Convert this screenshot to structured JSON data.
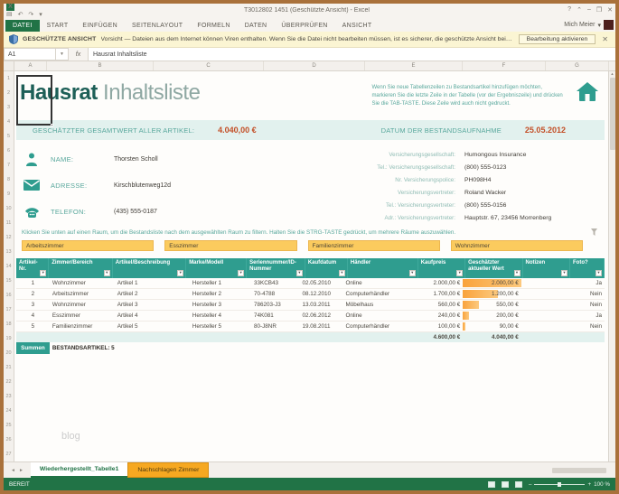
{
  "colors": {
    "excel_green": "#217346",
    "accent_teal": "#2f9d8f",
    "value_orange": "#c34f27",
    "slicer_orange": "#fbcb5e",
    "databar_orange": "#f9a33c",
    "tab_orange": "#f6a821"
  },
  "window": {
    "app_initial": "X",
    "title": "T3012802 1451 (Geschützte Ansicht) - Excel",
    "controls": [
      "?",
      "⌃",
      "–",
      "❐",
      "✕"
    ],
    "user_name": "Mich Meier",
    "user_caret": "▾"
  },
  "ribbon": {
    "tabs": [
      {
        "label": "DATEI",
        "active": true
      },
      {
        "label": "START",
        "active": false
      },
      {
        "label": "EINFÜGEN",
        "active": false
      },
      {
        "label": "SEITENLAYOUT",
        "active": false
      },
      {
        "label": "FORMELN",
        "active": false
      },
      {
        "label": "DATEN",
        "active": false
      },
      {
        "label": "ÜBERPRÜFEN",
        "active": false
      },
      {
        "label": "ANSICHT",
        "active": false
      }
    ]
  },
  "protected_view": {
    "label": "GESCHÜTZTE ANSICHT",
    "message": "Vorsicht — Dateien aus dem Internet können Viren enthalten. Wenn Sie die Datei nicht bearbeiten müssen, ist es sicherer, die geschützte Ansicht beizubehalten.",
    "button_label": "Bearbeitung aktivieren",
    "close_glyph": "✕"
  },
  "formula_bar": {
    "cell_ref": "A1",
    "fx_label": "fx",
    "value": "Hausrat Inhaltsliste"
  },
  "grid": {
    "column_letters": [
      "A",
      "B",
      "C",
      "D",
      "E",
      "F",
      "G"
    ],
    "row_numbers": [
      "1",
      "2",
      "3",
      "4",
      "5",
      "6",
      "7",
      "8",
      "9",
      "10",
      "11",
      "12",
      "13",
      "14",
      "15",
      "16",
      "17",
      "18",
      "19",
      "20",
      "21",
      "22",
      "23",
      "24",
      "25",
      "26",
      "27"
    ]
  },
  "sheet": {
    "title_bold": "Hausrat",
    "title_light": "Inhaltsliste",
    "top_instructions": "Wenn Sie neue Tabellenzeilen zu Bestandsartikel hinzufügen möchten, markieren Sie die letzte Zeile in der Tabelle (vor der Ergebniszeile) und drücken Sie die TAB-TASTE. Diese Zeile wird auch nicht gedruckt.",
    "summary_band": {
      "total_label": "GESCHÄTZTER GESAMTWERT ALLER ARTIKEL:",
      "total_value": "4.040,00 €",
      "date_label": "DATUM DER BESTANDSAUFNAHME",
      "date_value": "25.05.2012"
    },
    "contact_rows": [
      {
        "icon": "person-icon",
        "label": "NAME:",
        "value": "Thorsten Scholl"
      },
      {
        "icon": "envelope-icon",
        "label": "ADRESSE:",
        "value": "Kirschblutenweg12d"
      },
      {
        "icon": "phone-icon",
        "label": "TELEFON:",
        "value": "(435) 555-0187"
      }
    ],
    "insurance_rows": [
      {
        "label": "Versicherungsgesellschaft:",
        "value": "Humongous Insurance"
      },
      {
        "label": "Tel.: Versicherungsgesellschaft:",
        "value": "(800) 555-0123"
      },
      {
        "label": "Nr. Versicherungspolice:",
        "value": "PH098H4"
      },
      {
        "label": "Versicherungsvertreter:",
        "value": "Roland Wacker"
      },
      {
        "label": "Tel.: Versicherungsvertreter:",
        "value": "(800) 555-0156"
      },
      {
        "label": "Adr.: Versicherungsvertreter:",
        "value": "Hauptstr. 67, 23456 Morrenberg"
      }
    ],
    "filter_hint": "Klicken Sie unten auf einen Raum, um die Bestandsliste nach dem ausgewählten Raum zu filtern. Halten Sie die STRG-TASTE gedrückt, um mehrere Räume auszuwählen.",
    "room_filters": [
      "Arbeitszimmer",
      "Esszimmer",
      "Familienzimmer",
      "Wohnzimmer"
    ],
    "table": {
      "headers": [
        "Artikel-Nr.",
        "Zimmer/Bereich",
        "Artikel/Beschreibung",
        "Marke/Modell",
        "Seriennummer/ID-Nummer",
        "Kaufdatum",
        "Händler",
        "Kaufpreis",
        "Geschätzter aktueller Wert",
        "Notizen",
        "Foto?"
      ],
      "rows": [
        {
          "nr": "1",
          "zimmer": "Wohnzimmer",
          "artikel": "Artikel 1",
          "marke": "Hersteller 1",
          "serien": "33KCB43",
          "datum": "02.05.2010",
          "haendler": "Online",
          "kaufpreis": "2.000,00 €",
          "wert": "2.000,00 €",
          "wert_pct": 100,
          "notizen": "",
          "foto": "Ja"
        },
        {
          "nr": "2",
          "zimmer": "Arbeitszimmer",
          "artikel": "Artikel 2",
          "marke": "Hersteller 2",
          "serien": "70-4788",
          "datum": "08.12.2010",
          "haendler": "Computerhändler",
          "kaufpreis": "1.700,00 €",
          "wert": "1.200,00 €",
          "wert_pct": 60,
          "notizen": "",
          "foto": "Nein"
        },
        {
          "nr": "3",
          "zimmer": "Wohnzimmer",
          "artikel": "Artikel 3",
          "marke": "Hersteller 3",
          "serien": "786203-J3",
          "datum": "13.03.2011",
          "haendler": "Möbelhaus",
          "kaufpreis": "560,00 €",
          "wert": "550,00 €",
          "wert_pct": 28,
          "notizen": "",
          "foto": "Nein"
        },
        {
          "nr": "4",
          "zimmer": "Esszimmer",
          "artikel": "Artikel 4",
          "marke": "Hersteller 4",
          "serien": "74K081",
          "datum": "02.06.2012",
          "haendler": "Online",
          "kaufpreis": "240,00 €",
          "wert": "200,00 €",
          "wert_pct": 10,
          "notizen": "",
          "foto": "Ja"
        },
        {
          "nr": "5",
          "zimmer": "Familienzimmer",
          "artikel": "Artikel 5",
          "marke": "Hersteller 5",
          "serien": "80-J8NR",
          "datum": "19.08.2011",
          "haendler": "Computerhändler",
          "kaufpreis": "100,00 €",
          "wert": "90,00 €",
          "wert_pct": 5,
          "notizen": "",
          "foto": "Nein"
        }
      ],
      "totals": {
        "kaufpreis": "4.600,00 €",
        "wert": "4.040,00 €"
      },
      "summary_row": {
        "label": "Summen",
        "value": "BESTANDSARTIKEL: 5"
      }
    },
    "watermark": "blog"
  },
  "sheet_tabs": {
    "nav_left": "◄",
    "nav_right": "►",
    "tabs": [
      {
        "label": "Wiederhergestellt_Tabelle1",
        "active": true,
        "orange": false
      },
      {
        "label": "Nachschlagen Zimmer",
        "active": false,
        "orange": true
      }
    ]
  },
  "status_bar": {
    "ready_label": "BEREIT",
    "zoom_level": "100 %",
    "zoom_minus": "–",
    "zoom_plus": "+"
  }
}
